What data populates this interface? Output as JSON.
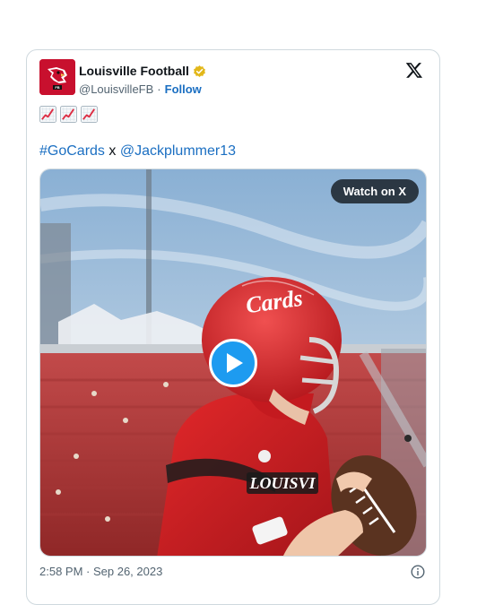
{
  "author": {
    "display_name": "Louisville Football",
    "handle": "@LouisvilleFB",
    "separator": "·",
    "follow_label": "Follow",
    "verified_icon": "verified-badge-gold",
    "avatar_icon": "cardinal-logo",
    "avatar_color": "#c8102e"
  },
  "platform": {
    "logo_icon": "x-logo"
  },
  "tweet": {
    "emoji_icons": [
      "chart-increasing-emoji",
      "chart-increasing-emoji",
      "chart-increasing-emoji"
    ],
    "hashtag": "#GoCards",
    "connector": "x",
    "mention": "@Jackplummer13"
  },
  "media": {
    "watch_label": "Watch on X",
    "play_icon": "play-icon",
    "play_color": "#1d9bf0"
  },
  "footer": {
    "timestamp": "2:58 PM · Sep 26, 2023",
    "info_icon": "info-icon"
  },
  "colors": {
    "link": "#1b6fc2",
    "text": "#0f1419",
    "muted": "#536471",
    "border": "#cfd9de"
  }
}
